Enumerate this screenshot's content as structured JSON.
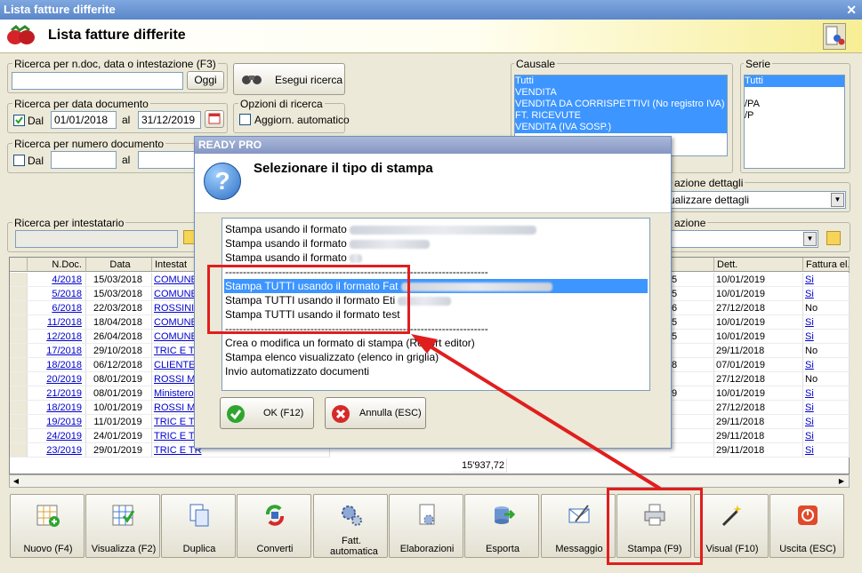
{
  "window": {
    "title": "Lista fatture differite",
    "heading": "Lista fatture differite"
  },
  "search": {
    "doc_group_label": "Ricerca per n.doc, data o intestazione (F3)",
    "oggi_label": "Oggi",
    "execute_label": "Esegui ricerca",
    "date_group_label": "Ricerca per data documento",
    "dal_label": "Dal",
    "al_label": "al",
    "date_from": "01/01/2018",
    "date_to": "31/12/2019",
    "options_group_label": "Opzioni di ricerca",
    "auto_update_label": "Aggiorn. automatico",
    "number_group_label": "Ricerca per numero documento",
    "num_dal_label": "Dal",
    "num_al_label": "al",
    "intestatario_label": "Ricerca per intestatario"
  },
  "causale": {
    "label": "Causale",
    "items": [
      "Tutti",
      "VENDITA",
      "VENDITA DA CORRISPETTIVI (No registro IVA)",
      "FT. RICEVUTE",
      "VENDITA (IVA SOSP.)"
    ]
  },
  "serie": {
    "label": "Serie",
    "items": [
      "Tutti",
      "",
      "/PA",
      "/P"
    ]
  },
  "details": {
    "label_fragment": "azione dettagli",
    "value_fragment": "ualizzare dettagli",
    "label2_fragment": "azione"
  },
  "grid": {
    "columns": [
      "N.Doc.",
      "Data",
      "Intestat",
      "Dett.",
      "Fattura el."
    ],
    "rows": [
      {
        "ndoc": "4/2018",
        "data": "15/03/2018",
        "intest": "COMUNE",
        "x": "5",
        "dett": "10/01/2019",
        "fel": "Si"
      },
      {
        "ndoc": "5/2018",
        "data": "15/03/2018",
        "intest": "COMUNE",
        "x": "5",
        "dett": "10/01/2019",
        "fel": "Si"
      },
      {
        "ndoc": "6/2018",
        "data": "22/03/2018",
        "intest": "ROSSINI",
        "x": "6",
        "dett": "27/12/2018",
        "fel": "No"
      },
      {
        "ndoc": "11/2018",
        "data": "18/04/2018",
        "intest": "COMUNE",
        "x": "5",
        "dett": "10/01/2019",
        "fel": "Si"
      },
      {
        "ndoc": "12/2018",
        "data": "26/04/2018",
        "intest": "COMUNE",
        "x": "5",
        "dett": "10/01/2019",
        "fel": "Si"
      },
      {
        "ndoc": "17/2018",
        "data": "29/10/2018",
        "intest": "TRIC E TR",
        "x": "",
        "dett": "29/11/2018",
        "fel": "No"
      },
      {
        "ndoc": "18/2018",
        "data": "06/12/2018",
        "intest": "CLIENTE I",
        "x": "8",
        "dett": "07/01/2019",
        "fel": "Si"
      },
      {
        "ndoc": "20/2019",
        "data": "08/01/2019",
        "intest": "ROSSI MA",
        "x": "",
        "dett": "27/12/2018",
        "fel": "No"
      },
      {
        "ndoc": "21/2019",
        "data": "08/01/2019",
        "intest": "Ministero",
        "x": "9",
        "dett": "10/01/2019",
        "fel": "Si"
      },
      {
        "ndoc": "18/2019",
        "data": "10/01/2019",
        "intest": "ROSSI MA",
        "x": "",
        "dett": "27/12/2018",
        "fel": "Si"
      },
      {
        "ndoc": "19/2019",
        "data": "11/01/2019",
        "intest": "TRIC E TR",
        "x": "",
        "dett": "29/11/2018",
        "fel": "Si"
      },
      {
        "ndoc": "24/2019",
        "data": "24/01/2019",
        "intest": "TRIC E TR",
        "x": "",
        "dett": "29/11/2018",
        "fel": "Si"
      },
      {
        "ndoc": "23/2019",
        "data": "29/01/2019",
        "intest": "TRIC E TR",
        "x": "",
        "dett": "29/11/2018",
        "fel": "Si"
      }
    ],
    "total": "15'937,72"
  },
  "toolbar": [
    {
      "label": "Nuovo (F4)",
      "icon": "new-grid-icon"
    },
    {
      "label": "Visualizza (F2)",
      "icon": "view-grid-icon"
    },
    {
      "label": "Duplica",
      "icon": "duplicate-icon"
    },
    {
      "label": "Converti",
      "icon": "convert-icon"
    },
    {
      "label": "Fatt. automatica",
      "icon": "gears-icon"
    },
    {
      "label": "Elaborazioni",
      "icon": "processing-icon"
    },
    {
      "label": "Esporta",
      "icon": "export-icon"
    },
    {
      "label": "Messaggio",
      "icon": "message-icon"
    },
    {
      "label": "Stampa (F9)",
      "icon": "printer-icon"
    },
    {
      "label": "Visual (F10)",
      "icon": "magic-wand-icon"
    },
    {
      "label": "Uscita (ESC)",
      "icon": "power-icon"
    }
  ],
  "dialog": {
    "title": "READY PRO",
    "heading": "Selezionare il tipo di stampa",
    "options": [
      "Stampa usando il formato",
      "Stampa usando il formato",
      "Stampa usando il formato",
      "--------------------------------------------------------------------------",
      "Stampa TUTTI usando il formato Fat",
      "Stampa TUTTI usando il formato Eti",
      "Stampa TUTTI usando il formato test",
      "--------------------------------------------------------------------------",
      "Crea o modifica un formato di stampa (Report editor)",
      "Stampa elenco visualizzato (elenco in griglia)",
      "Invio automatizzato documenti"
    ],
    "ok_label": "OK (F12)",
    "cancel_label": "Annulla (ESC)"
  },
  "colors": {
    "selection": "#3d95ff",
    "highlight": "#e01e1e",
    "title": "#5b86c8"
  }
}
